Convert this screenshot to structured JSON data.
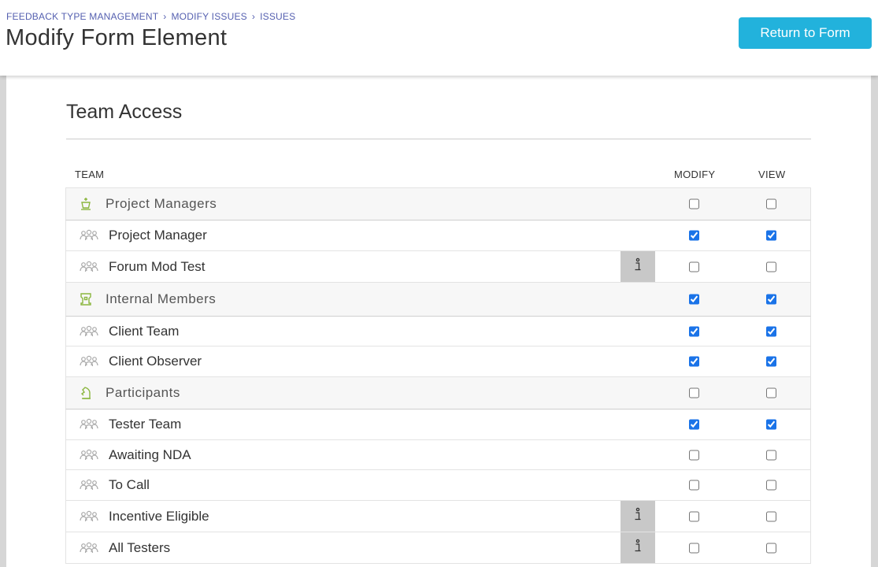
{
  "breadcrumb": [
    "FEEDBACK TYPE MANAGEMENT",
    "MODIFY ISSUES",
    "ISSUES"
  ],
  "page_title": "Modify Form Element",
  "return_button": "Return to Form",
  "section_title": "Team Access",
  "columns": {
    "team": "TEAM",
    "modify": "MODIFY",
    "view": "VIEW"
  },
  "rows": [
    {
      "type": "group",
      "icon": "chess-king-icon",
      "label": "Project Managers",
      "modify": false,
      "view": false,
      "info": false
    },
    {
      "type": "member",
      "icon": "users-icon",
      "label": "Project Manager",
      "modify": true,
      "view": true,
      "info": false
    },
    {
      "type": "member",
      "icon": "users-icon",
      "label": "Forum Mod Test",
      "modify": false,
      "view": false,
      "info": true
    },
    {
      "type": "group",
      "icon": "chess-rook-icon",
      "label": "Internal Members",
      "modify": true,
      "view": true,
      "info": false
    },
    {
      "type": "member",
      "icon": "users-icon",
      "label": "Client Team",
      "modify": true,
      "view": true,
      "info": false
    },
    {
      "type": "member",
      "icon": "users-icon",
      "label": "Client Observer",
      "modify": true,
      "view": true,
      "info": false
    },
    {
      "type": "group",
      "icon": "chess-knight-icon",
      "label": "Participants",
      "modify": false,
      "view": false,
      "info": false
    },
    {
      "type": "member",
      "icon": "users-icon",
      "label": "Tester Team",
      "modify": true,
      "view": true,
      "info": false
    },
    {
      "type": "member",
      "icon": "users-icon",
      "label": "Awaiting NDA",
      "modify": false,
      "view": false,
      "info": false
    },
    {
      "type": "member",
      "icon": "users-icon",
      "label": "To Call",
      "modify": false,
      "view": false,
      "info": false
    },
    {
      "type": "member",
      "icon": "users-icon",
      "label": "Incentive Eligible",
      "modify": false,
      "view": false,
      "info": true
    },
    {
      "type": "member",
      "icon": "users-icon",
      "label": "All Testers",
      "modify": false,
      "view": false,
      "info": true
    }
  ],
  "colors": {
    "accent": "#22b2dc",
    "link": "#5560b0",
    "group_icon": "#8bb63f",
    "checkbox": "#1a73e8"
  }
}
